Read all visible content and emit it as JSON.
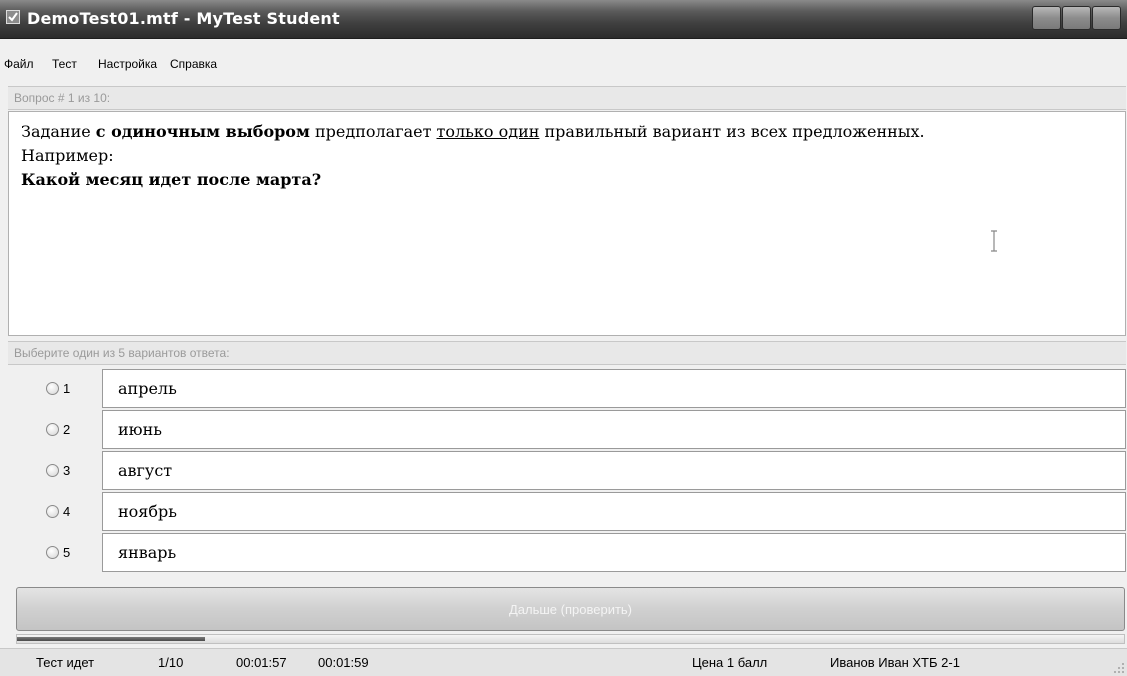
{
  "window": {
    "title": "DemoTest01.mtf - MyTest Student"
  },
  "menu": [
    "Файл",
    "Тест",
    "Настройка",
    "Справка"
  ],
  "question": {
    "header": "Вопрос # 1 из 10:",
    "line1": {
      "part1": "Задание ",
      "bold": "с одиночным выбором",
      "part2": " предполагает ",
      "underline": "только один",
      "part3": " правильный вариант из всех предложенных."
    },
    "line2": "Например:",
    "line3": "Какой месяц идет после марта?"
  },
  "answers": {
    "header": "Выберите один из 5 вариантов ответа:",
    "options": [
      {
        "num": "1",
        "text": "апрель"
      },
      {
        "num": "2",
        "text": "июнь"
      },
      {
        "num": "3",
        "text": "август"
      },
      {
        "num": "4",
        "text": "ноябрь"
      },
      {
        "num": "5",
        "text": "январь"
      }
    ]
  },
  "next_button": "Дальше (проверить)",
  "progress_fraction": 0.17,
  "status": {
    "state": "Тест идет",
    "counter": "1/10",
    "time1": "00:01:57",
    "time2": "00:01:59",
    "price": "Цена 1 балл",
    "student": "Иванов Иван ХТБ 2-1"
  },
  "icons": {
    "window_check": "checkbox-icon",
    "cursor": "ibeam-cursor-icon",
    "grip": "resize-grip-icon"
  }
}
